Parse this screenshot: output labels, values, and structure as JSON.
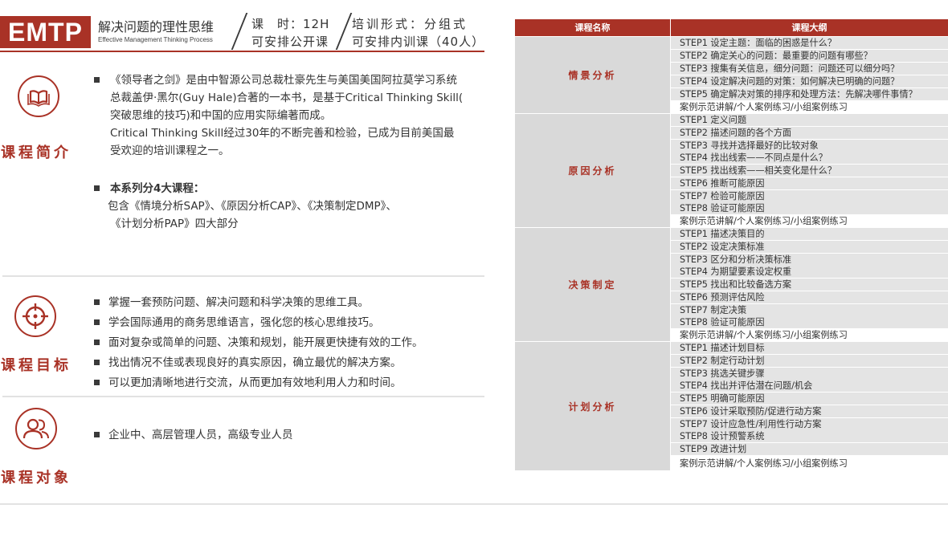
{
  "header": {
    "logo": "EMTP",
    "course_title": "解决问题的理性思维",
    "course_subtitle": "Effective Management Thinking Process",
    "hours": "课　时：12H",
    "open_class": "可安排公开课",
    "format": "培训形式：分组式",
    "inhouse": "可安排内训课（40人）"
  },
  "intro": {
    "title": "课程简介",
    "paragraph_lines": [
      "《领导者之剑》是由中智源公司总裁杜豪先生与美国美国阿拉莫学习系统",
      "总裁盖伊·黑尔(Guy Hale)合著的一本书，是基于Critical Thinking Skill(",
      "突破思维的技巧)和中国的应用实际编著而成。",
      "Critical Thinking Skill经过30年的不断完善和检验，已成为目前美国最",
      "受欢迎的培训课程之一。"
    ],
    "series_heading": "本系列分4大课程：",
    "series_lines": [
      "包含《情境分析SAP》、《原因分析CAP》、《决策制定DMP》、",
      "《计划分析PAP》四大部分"
    ]
  },
  "goals": {
    "title": "课程目标",
    "items": [
      "掌握一套预防问题、解决问题和科学决策的思维工具。",
      "学会国际通用的商务思维语言，强化您的核心思维技巧。",
      "面对复杂或简单的问题、决策和规划，能开展更快捷有效的工作。",
      "找出情况不佳或表现良好的真实原因，确立最优的解决方案。",
      "可以更加清晰地进行交流，从而更加有效地利用人力和时间。"
    ]
  },
  "audience": {
    "title": "课程对象",
    "items": [
      "企业中、高层管理人员，高级专业人员"
    ]
  },
  "outline_table": {
    "col_name": "课程名称",
    "col_outline": "课程大纲",
    "groups": [
      {
        "name": "情景分析",
        "steps": [
          "STEP1 设定主题：面临的困惑是什么？",
          "STEP2 确定关心的问题：最重要的问题有哪些？",
          "STEP3 搜集有关信息，细分问题：问题还可以细分吗？",
          "STEP4 设定解决问题的对策：如何解决已明确的问题？",
          "STEP5 确定解决对策的排序和处理方法：先解决哪件事情？",
          "案例示范讲解/个人案例练习/小组案例练习"
        ]
      },
      {
        "name": "原因分析",
        "steps": [
          "STEP1 定义问题",
          "STEP2 描述问题的各个方面",
          "STEP3 寻找并选择最好的比较对象",
          "STEP4 找出线索——不同点是什么？",
          "STEP5 找出线索——相关变化是什么？",
          "STEP6 推断可能原因",
          "STEP7 检验可能原因",
          "STEP8 验证可能原因",
          "案例示范讲解/个人案例练习/小组案例练习"
        ]
      },
      {
        "name": "决策制定",
        "steps": [
          "STEP1 描述决策目的",
          "STEP2 设定决策标准",
          "STEP3 区分和分析决策标准",
          "STEP4 为期望要素设定权重",
          "STEP5 找出和比较备选方案",
          "STEP6 预测评估风险",
          "STEP7 制定决策",
          "STEP8 验证可能原因",
          "案例示范讲解/个人案例练习/小组案例练习"
        ]
      },
      {
        "name": "计划分析",
        "steps": [
          "STEP1 描述计划目标",
          "STEP2 制定行动计划",
          "STEP3 挑选关键步骤",
          "STEP4 找出并评估潜在问题/机会",
          "STEP5 明确可能原因",
          "STEP6 设计采取预防/促进行动方案",
          "STEP7 设计应急性/利用性行动方案",
          "STEP8 设计预警系统",
          "STEP9 改进计划",
          "案例示范讲解/个人案例练习/小组案例练习"
        ]
      }
    ]
  },
  "colors": {
    "accent": "#a93226",
    "group_bg": "#d9d9d9",
    "step_bg": "#e4e4e4",
    "divider": "#e2e2e2"
  },
  "icons": {
    "intro": "book-icon",
    "goals": "target-icon",
    "audience": "people-icon"
  }
}
